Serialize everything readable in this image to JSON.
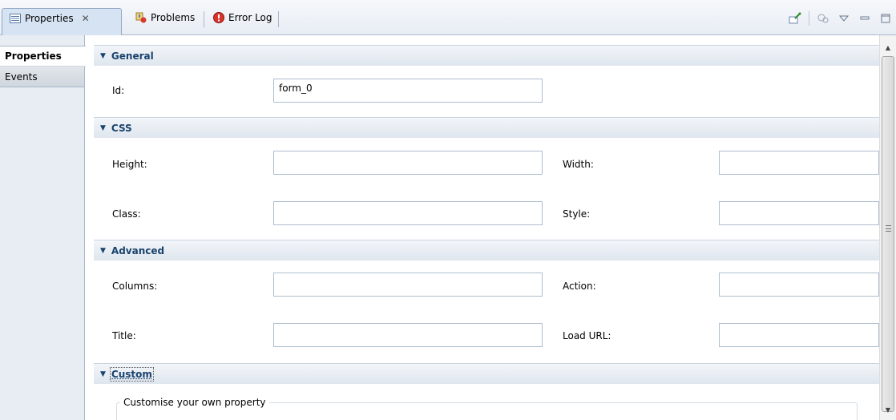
{
  "tabs": {
    "properties": "Properties",
    "problems": "Problems",
    "error_log": "Error Log",
    "close_glyph": "✕"
  },
  "side_tabs": {
    "properties": "Properties",
    "events": "Events"
  },
  "sections": {
    "general": "General",
    "css": "CSS",
    "advanced": "Advanced",
    "custom": "Custom"
  },
  "fields": {
    "id_label": "Id:",
    "id_value": "form_0",
    "height_label": "Height:",
    "width_label": "Width:",
    "class_label": "Class:",
    "style_label": "Style:",
    "columns_label": "Columns:",
    "action_label": "Action:",
    "title_label": "Title:",
    "load_url_label": "Load URL:"
  },
  "custom_group_legend": "Customise your own property",
  "toolbar_icons": [
    "pin-icon",
    "filter-icon",
    "view-menu-icon",
    "minimize-icon",
    "maximize-icon"
  ],
  "colors": {
    "section_title": "#19426e",
    "active_tab": "#d6e3f3"
  }
}
